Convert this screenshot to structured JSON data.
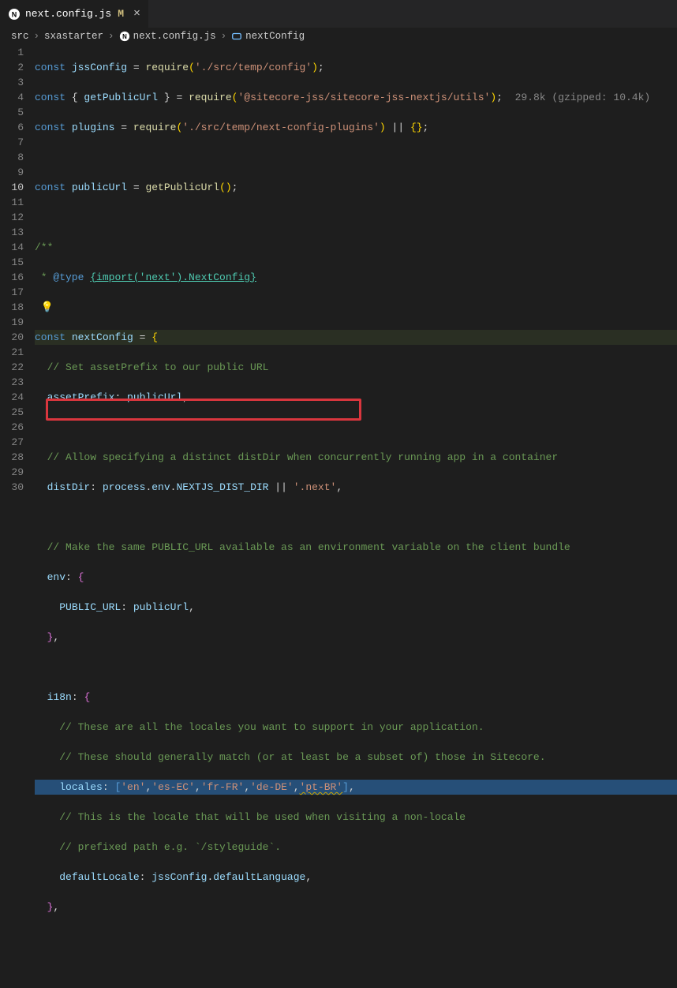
{
  "tab": {
    "filename": "next.config.js",
    "modified_badge": "M",
    "close": "×"
  },
  "breadcrumb": {
    "items": [
      "src",
      "sxastarter",
      "next.config.js",
      "nextConfig"
    ]
  },
  "gutter": {
    "start": 1,
    "end": 30,
    "active": 10
  },
  "code": {
    "l1": {
      "kw": "const",
      "v": "jssConfig",
      "op": " = ",
      "fn": "require",
      "paren": "(",
      "str": "'./src/temp/config'",
      "paren2": ")",
      "semi": ";"
    },
    "l2": {
      "kw": "const",
      "lb": " { ",
      "v": "getPublicUrl",
      "rb": " } = ",
      "fn": "require",
      "p": "(",
      "str": "'@sitecore-jss/sitecore-jss-nextjs/utils'",
      "p2": ")",
      "semi": ";",
      "hint": "  29.8k (gzipped: 10.4k)"
    },
    "l3": {
      "kw": "const",
      "v": " plugins",
      "op": " = ",
      "fn": "require",
      "p": "(",
      "str": "'./src/temp/next-config-plugins'",
      "p2": ")",
      "or": " || ",
      "empty": "{}",
      "semi": ";"
    },
    "l5": {
      "kw": "const",
      "v": " publicUrl",
      "op": " = ",
      "fn": "getPublicUrl",
      "call": "()",
      "semi": ";"
    },
    "l7": {
      "c": "/**"
    },
    "l8": {
      "c1": " * ",
      "tag": "@type",
      "c2": " ",
      "link": "{import('next').NextConfig}"
    },
    "l9": {
      "bulb": "💡"
    },
    "l10": {
      "kw": "const",
      "v": " nextConfig",
      "op": " = ",
      "brace": "{"
    },
    "l11": {
      "c": "// Set assetPrefix to our public URL"
    },
    "l12": {
      "p": "assetPrefix",
      "colon": ": ",
      "v": "publicUrl",
      "comma": ","
    },
    "l14": {
      "c": "// Allow specifying a distinct distDir when concurrently running app in a container"
    },
    "l15": {
      "p": "distDir",
      "colon": ": ",
      "o": "process",
      "d1": ".",
      "e": "env",
      "d2": ".",
      "dd": "NEXTJS_DIST_DIR",
      "or": " || ",
      "str": "'.next'",
      "comma": ","
    },
    "l17": {
      "c": "// Make the same PUBLIC_URL available as an environment variable on the client bundle"
    },
    "l18": {
      "p": "env",
      "colon": ": ",
      "brace": "{"
    },
    "l19": {
      "p": "PUBLIC_URL",
      "colon": ": ",
      "v": "publicUrl",
      "comma": ","
    },
    "l20": {
      "brace": "}",
      "comma": ","
    },
    "l22": {
      "p": "i18n",
      "colon": ": ",
      "brace": "{"
    },
    "l23": {
      "c": "// These are all the locales you want to support in your application."
    },
    "l24": {
      "c": "// These should generally match (or at least be a subset of) those in Sitecore."
    },
    "l25": {
      "p": "locales",
      "colon": ": ",
      "lb": "[",
      "s1": "'en'",
      "c1": ",",
      "s2": "'es-EC'",
      "c2": ",",
      "s3": "'fr-FR'",
      "c3": ",",
      "s4": "'de-DE'",
      "c4": ",",
      "s5": "'pt-BR'",
      "rb": "]",
      "comma": ","
    },
    "l26": {
      "c": "// This is the locale that will be used when visiting a non-locale"
    },
    "l27": {
      "c": "// prefixed path e.g. `/styleguide`."
    },
    "l28": {
      "p": "defaultLocale",
      "colon": ": ",
      "o": "jssConfig",
      "d": ".",
      "dl": "defaultLanguage",
      "comma": ","
    },
    "l29": {
      "brace": "}",
      "comma": ","
    }
  }
}
